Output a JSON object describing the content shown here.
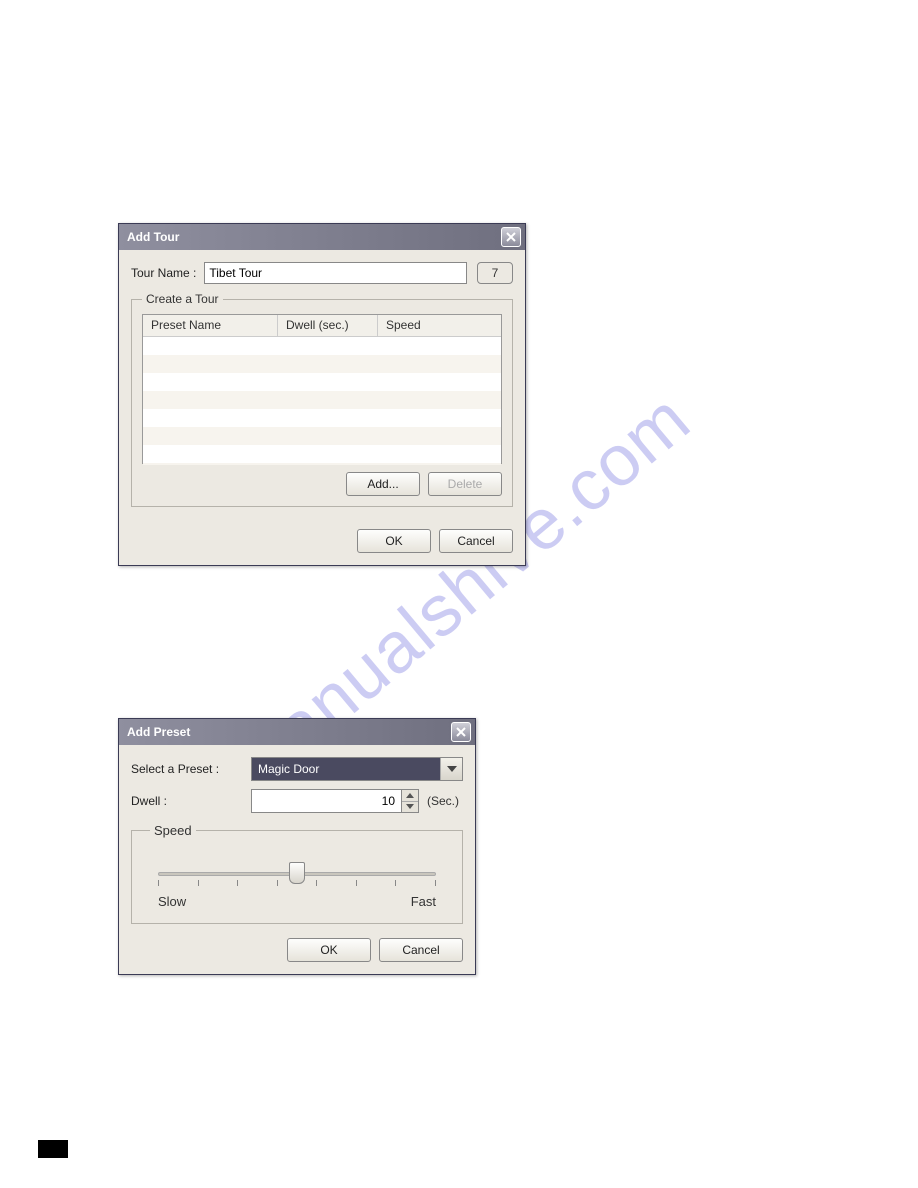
{
  "watermark": "manualshive.com",
  "dialog1": {
    "title": "Add Tour",
    "tourNameLabel": "Tour Name :",
    "tourNameValue": "Tibet Tour",
    "tourNumber": "7",
    "groupLegend": "Create a Tour",
    "columns": {
      "preset": "Preset Name",
      "dwell": "Dwell (sec.)",
      "speed": "Speed"
    },
    "addBtn": "Add...",
    "deleteBtn": "Delete",
    "okBtn": "OK",
    "cancelBtn": "Cancel"
  },
  "dialog2": {
    "title": "Add Preset",
    "selectLabel": "Select a Preset :",
    "selectValue": "Magic Door",
    "dwellLabel": "Dwell :",
    "dwellValue": "10",
    "dwellUnit": "(Sec.)",
    "speedLegend": "Speed",
    "slowLabel": "Slow",
    "fastLabel": "Fast",
    "okBtn": "OK",
    "cancelBtn": "Cancel"
  }
}
